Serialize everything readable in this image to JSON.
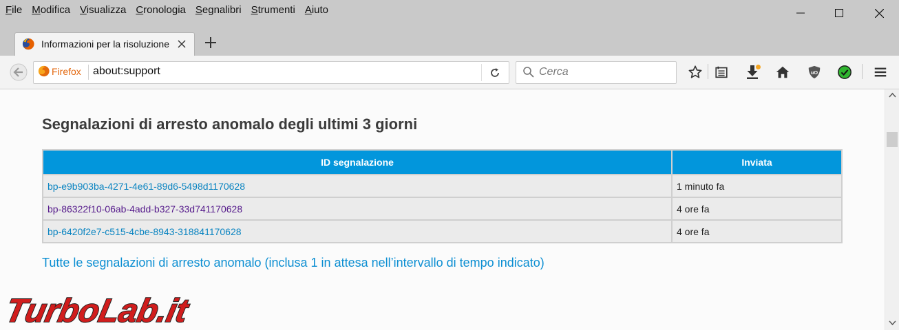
{
  "menubar": {
    "items": [
      {
        "accel": "F",
        "rest": "ile"
      },
      {
        "accel": "M",
        "rest": "odifica"
      },
      {
        "accel": "V",
        "rest": "isualizza"
      },
      {
        "accel": "C",
        "rest": "ronologia"
      },
      {
        "accel": "S",
        "rest": "egnalibri"
      },
      {
        "accel": "S",
        "rest": "trumenti"
      },
      {
        "accel": "A",
        "rest": "iuto"
      }
    ]
  },
  "tab": {
    "title": "Informazioni per la risoluzione dei problemi",
    "icon": "firefox-logo-icon"
  },
  "navbar": {
    "identity_label": "Firefox",
    "url": "about:support",
    "search_placeholder": "Cerca"
  },
  "colors": {
    "table_header": "#0296dc",
    "link": "#0a84c1",
    "visited_link": "#551a8b",
    "accent_green": "#2fb52f",
    "download_badge": "#f5a623"
  },
  "page": {
    "heading": "Segnalazioni di arresto anomalo degli ultimi 3 giorni",
    "table": {
      "headers": [
        "ID segnalazione",
        "Inviata"
      ],
      "rows": [
        {
          "id": "bp-e9b903ba-4271-4e61-89d6-5498d1170628",
          "sent": "1 minuto fa",
          "visited": false
        },
        {
          "id": "bp-86322f10-06ab-4add-b327-33d741170628",
          "sent": "4 ore fa",
          "visited": true
        },
        {
          "id": "bp-6420f2e7-c515-4cbe-8943-318841170628",
          "sent": "4 ore fa",
          "visited": false
        }
      ]
    },
    "all_reports_link": "Tutte le segnalazioni di arresto anomalo (inclusa 1 in attesa nell’intervallo di tempo indicato)"
  },
  "watermark": {
    "text_main": "TurboLab",
    "text_suffix": ".it"
  }
}
